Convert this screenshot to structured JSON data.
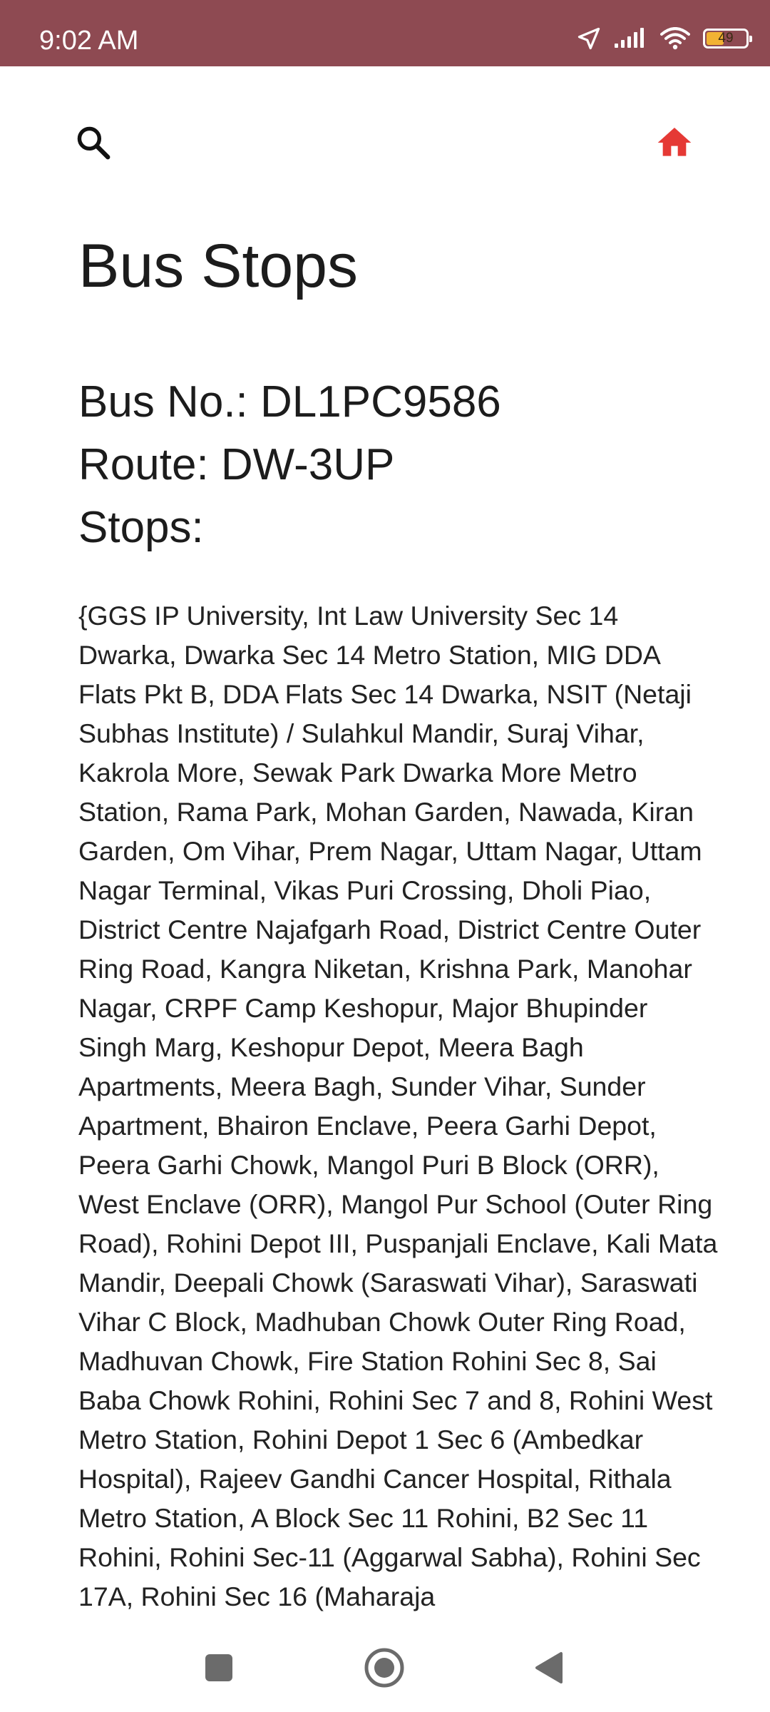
{
  "status_bar": {
    "time": "9:02 AM",
    "battery_level": "49",
    "battery_fraction": 0.49,
    "background_color": "#8e4a52",
    "battery_color": "#f2b233",
    "icons": [
      "location-arrow-icon",
      "signal-icon",
      "wifi-icon",
      "battery-icon"
    ]
  },
  "app_bar": {
    "search_icon": "search-icon",
    "home_icon": "home-icon",
    "home_icon_color": "#e53935"
  },
  "page": {
    "title": "Bus Stops"
  },
  "bus": {
    "number_line": "Bus No.: DL1PC9586",
    "route_line": "Route: DW-3UP",
    "stops_label": "Stops:"
  },
  "stops": {
    "text": "{GGS IP University, Int Law University Sec 14 Dwarka, Dwarka Sec 14 Metro Station, MIG DDA Flats Pkt B, DDA Flats Sec 14 Dwarka, NSIT (Netaji Subhas Institute) / Sulahkul Mandir, Suraj Vihar, Kakrola More, Sewak Park Dwarka More Metro Station, Rama Park, Mohan Garden, Nawada, Kiran Garden, Om Vihar, Prem Nagar, Uttam Nagar, Uttam Nagar Terminal, Vikas Puri Crossing, Dholi Piao, District Centre Najafgarh Road, District Centre Outer Ring Road, Kangra Niketan, Krishna Park, Manohar Nagar, CRPF Camp Keshopur, Major Bhupinder Singh Marg, Keshopur Depot, Meera Bagh Apartments, Meera Bagh, Sunder Vihar, Sunder Apartment, Bhairon Enclave, Peera Garhi Depot, Peera Garhi Chowk, Mangol Puri B Block (ORR), West Enclave (ORR), Mangol Pur School (Outer Ring Road), Rohini Depot III, Puspanjali Enclave, Kali Mata Mandir, Deepali Chowk (Saraswati Vihar), Saraswati Vihar C Block, Madhuban Chowk Outer Ring Road, Madhuvan Chowk, Fire Station Rohini Sec 8, Sai Baba Chowk Rohini, Rohini Sec 7 and 8, Rohini West Metro Station, Rohini Depot 1 Sec 6 (Ambedkar Hospital), Rajeev Gandhi Cancer Hospital, Rithala Metro Station, A Block Sec 11 Rohini, B2 Sec 11 Rohini, Rohini Sec-11 (Aggarwal Sabha), Rohini Sec 17A, Rohini Sec 16 (Maharaja"
  },
  "nav_bar": {
    "recents_icon": "recents-square-icon",
    "home_icon": "home-circle-icon",
    "back_icon": "back-triangle-icon"
  }
}
